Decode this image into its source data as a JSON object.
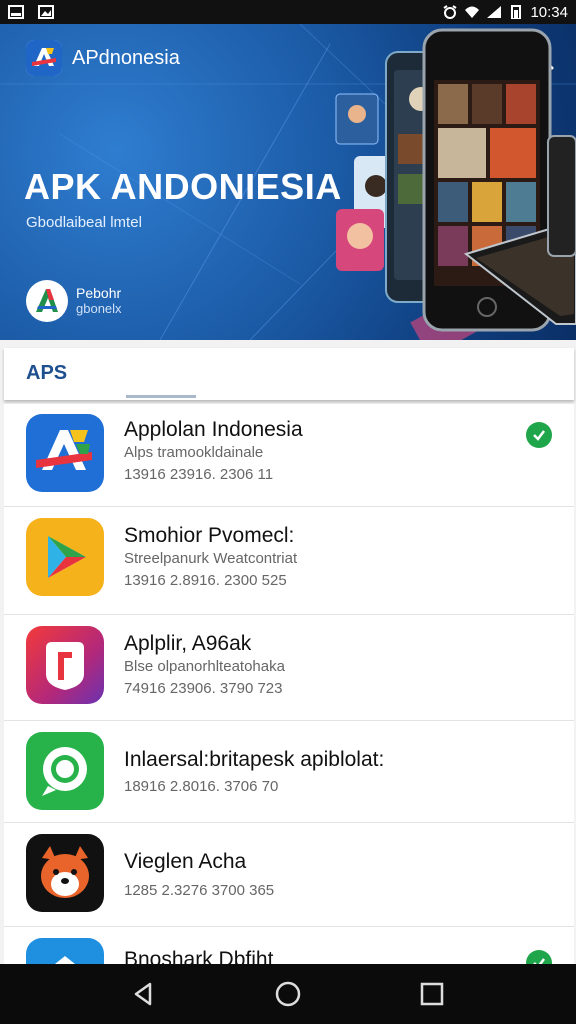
{
  "status_bar": {
    "time": "10:34"
  },
  "header": {
    "brand_name": "APdnonesia",
    "title": "APK ANDONIESIA",
    "subtitle": "Gbodlaibeal lmtel",
    "badge_line1": "Pebohr",
    "badge_line2": "gbonelx"
  },
  "tabs": {
    "active_label": "APS"
  },
  "apps": [
    {
      "name": "Applolan Indonesia",
      "meta": "Alps tramookldainale",
      "size": "13916 23916. 2306 11",
      "installed": true
    },
    {
      "name": "Smohior Pvomecl:",
      "meta": "Streelpanurk Weatcontriat",
      "size": "13916 2.8916. 2300 525",
      "installed": false
    },
    {
      "name": "Aplplir, A96ak",
      "meta": "Blse olpanorhlteatohaka",
      "size": "74916 23906. 3790 723",
      "installed": false
    },
    {
      "name": "Inlaersal:britapesk apiblolat:",
      "meta": "",
      "size": "18916 2.8016. 3706 70",
      "installed": false
    },
    {
      "name": "Vieglen Acha",
      "meta": "",
      "size": "1285 2.3276 3700 365",
      "installed": false
    },
    {
      "name": "Bnoshark Dbfiht",
      "meta": "",
      "size": "",
      "installed": true
    }
  ],
  "colors": {
    "hero_blue": "#1b5aa5",
    "accent": "#1e4f8f",
    "check_green": "#1fa64a"
  }
}
